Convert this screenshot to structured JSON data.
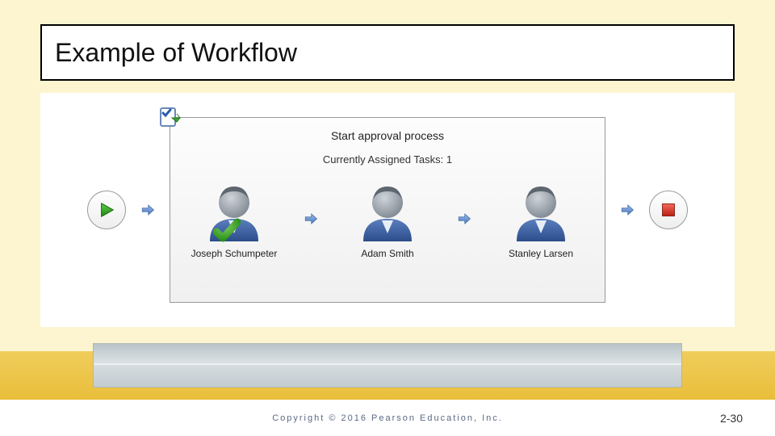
{
  "title": "Example of Workflow",
  "panel": {
    "title": "Start approval process",
    "subtitle": "Currently Assigned Tasks: 1"
  },
  "people": [
    {
      "name": "Joseph Schumpeter",
      "approved": true
    },
    {
      "name": "Adam Smith",
      "approved": false
    },
    {
      "name": "Stanley Larsen",
      "approved": false
    }
  ],
  "footer": {
    "copyright": "Copyright © 2016 Pearson Education, Inc.",
    "page": "2-30"
  }
}
